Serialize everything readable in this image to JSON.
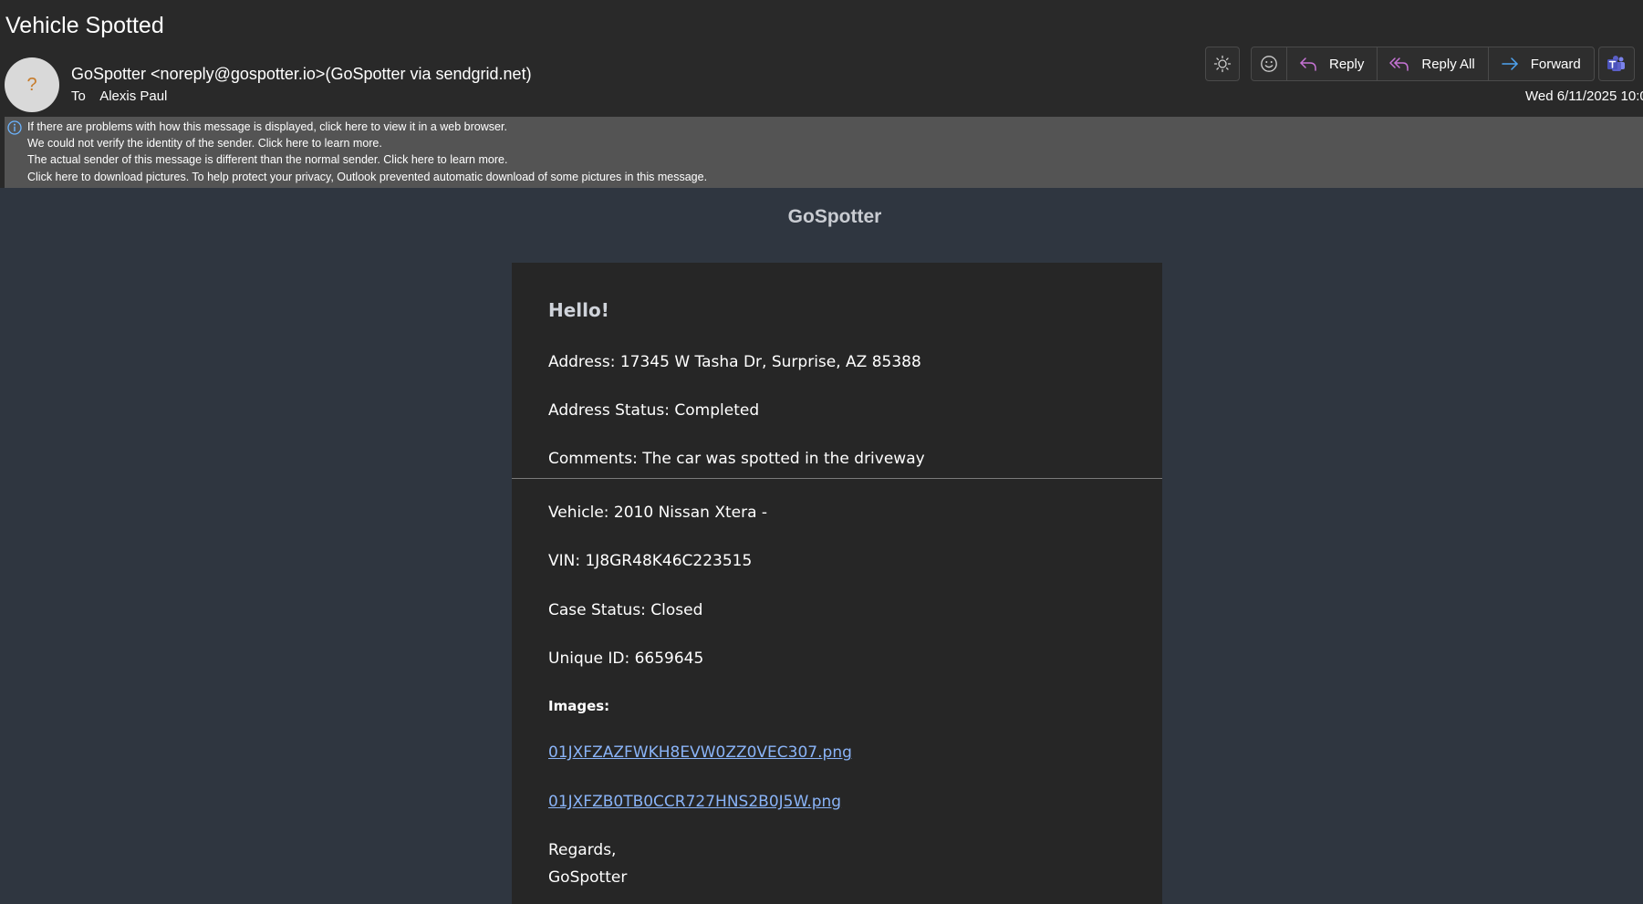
{
  "email": {
    "subject": "Vehicle Spotted",
    "avatar_glyph": "?",
    "from": "GoSpotter <noreply@gospotter.io>(GoSpotter via sendgrid.net)",
    "to_label": "To",
    "to_name": "Alexis Paul",
    "date": "Wed 6/11/2025 10:0"
  },
  "toolbar": {
    "reply_label": "Reply",
    "reply_all_label": "Reply All",
    "forward_label": "Forward"
  },
  "infobar": {
    "lines": [
      "If there are problems with how this message is displayed, click here to view it in a web browser.",
      "We could not verify the identity of the sender. Click here to learn more.",
      "The actual sender of this message is different than the normal sender. Click here to learn more.",
      "Click here to download pictures. To help protect your privacy, Outlook prevented automatic download of some pictures in this message."
    ]
  },
  "message": {
    "brand": "GoSpotter",
    "greeting": "Hello!",
    "address": "Address: 17345 W Tasha Dr, Surprise, AZ 85388",
    "address_status": "Address Status: Completed",
    "comments": "Comments: The car was spotted in the driveway",
    "vehicle": "Vehicle: 2010 Nissan Xtera -",
    "vin": "VIN: 1J8GR48K46C223515",
    "case_status": "Case Status: Closed",
    "unique_id": "Unique ID: 6659645",
    "images_label": "Images:",
    "image_links": [
      "01JXFZAZFWKH8EVW0ZZ0VEC307.png",
      "01JXFZB0TB0CCR727HNS2B0J5W.png"
    ],
    "regards": "Regards,",
    "signature": "GoSpotter"
  },
  "colors": {
    "header_bg": "#292929",
    "infobar_bg": "#545454",
    "body_bg": "#2f3640",
    "card_bg": "#262626",
    "link": "#8ab4f8",
    "reply_icon": "#c774d6",
    "forward_icon": "#4ea3f1",
    "teams_icon": "#5b5fc7"
  },
  "icons": [
    "sun-icon",
    "emoji-icon",
    "reply-icon",
    "reply-all-icon",
    "forward-icon",
    "teams-icon",
    "info-icon"
  ]
}
